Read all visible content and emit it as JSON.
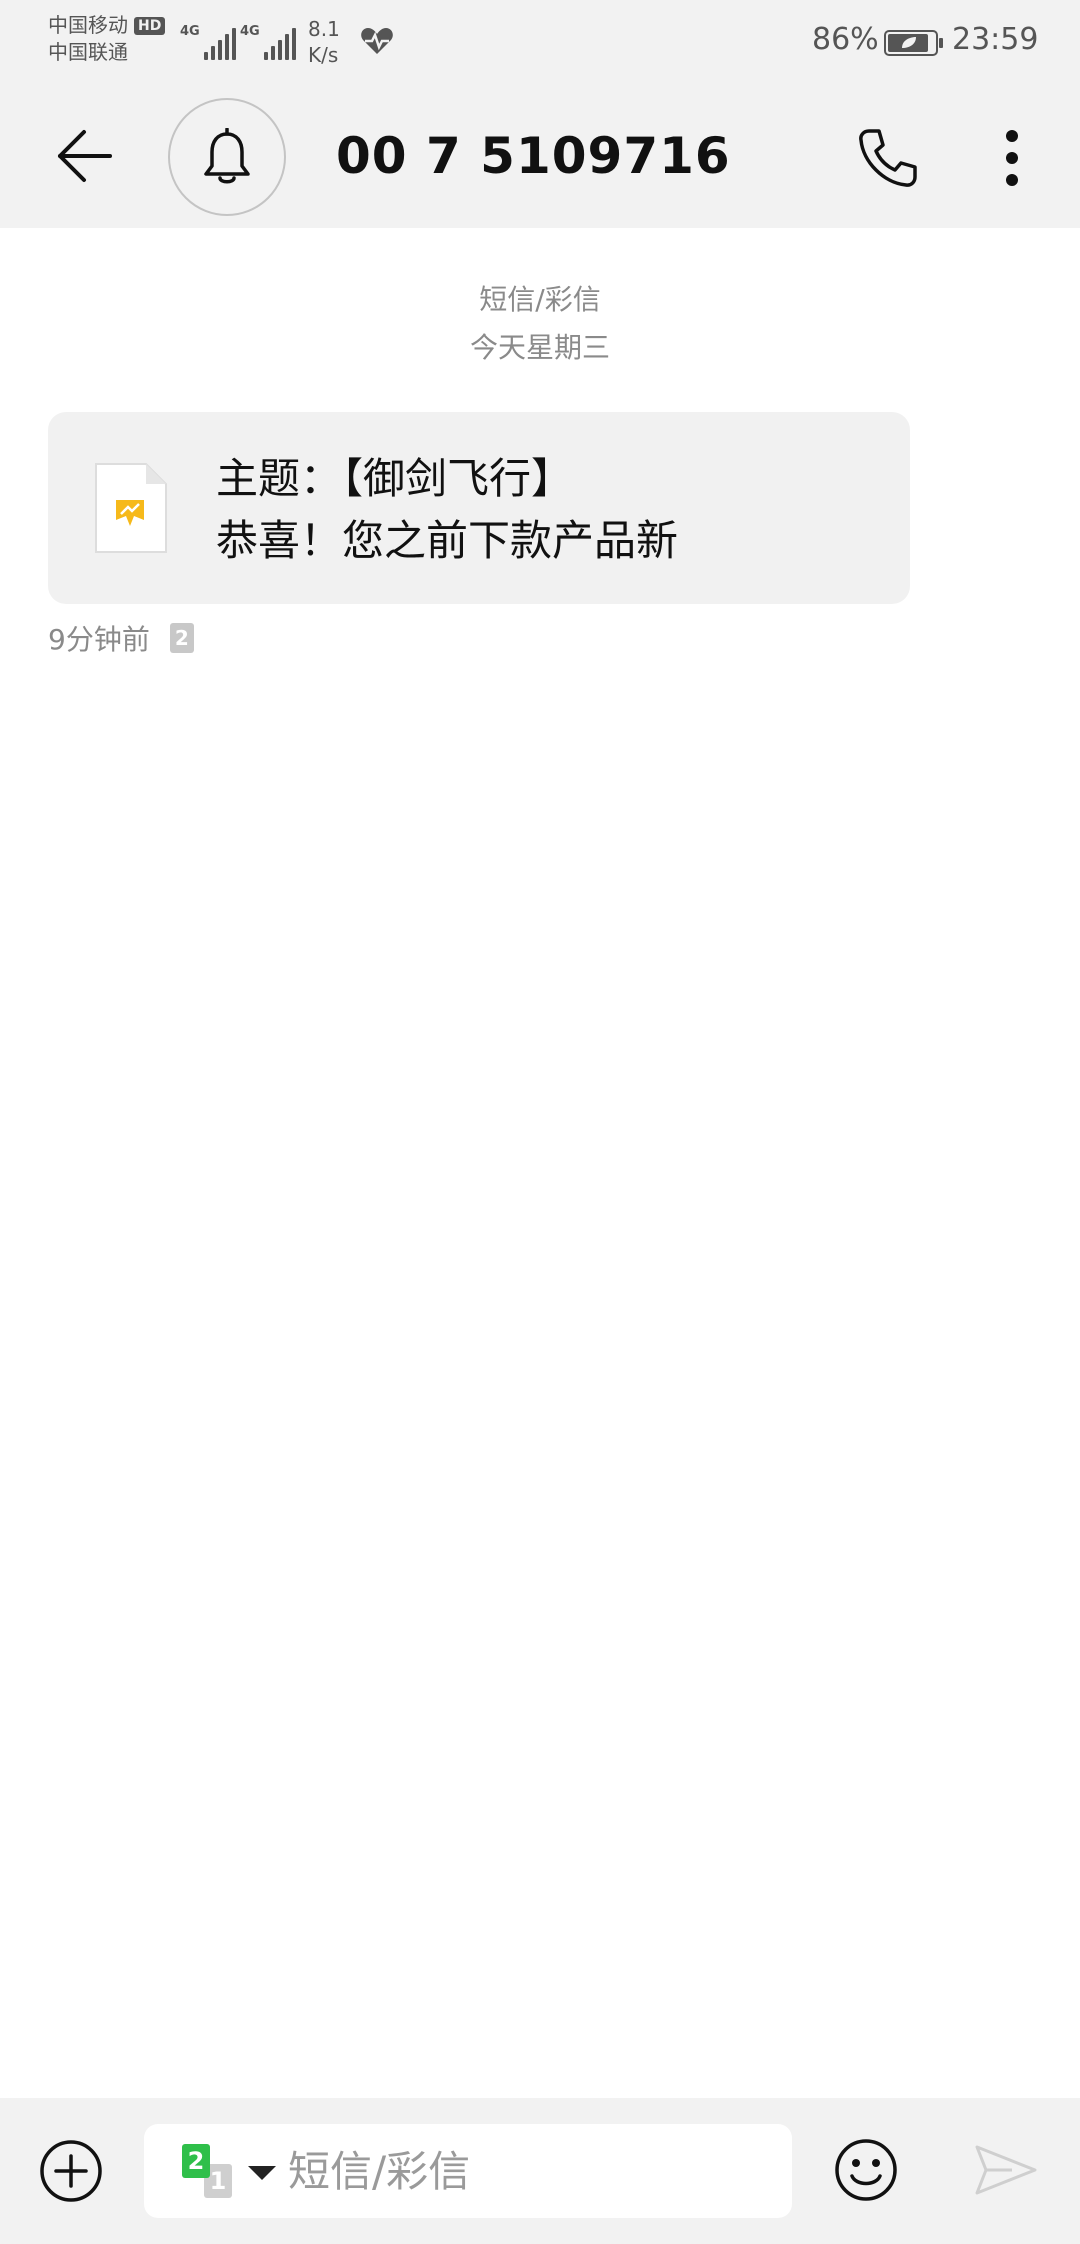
{
  "status_bar": {
    "carrier_1": "中国移动",
    "hd_badge": "HD",
    "carrier_2": "中国联通",
    "signal_1_label": "4G",
    "signal_2_label": "4G",
    "net_speed_value": "8.1",
    "net_speed_unit": "K/s",
    "battery_percent": "86%",
    "time": "23:59",
    "icons": [
      "heart-rate-icon",
      "battery-icon"
    ]
  },
  "header": {
    "title": "00 7 5109716",
    "icons": [
      "back-arrow-icon",
      "bell-icon",
      "phone-icon",
      "more-vert-icon"
    ]
  },
  "conversation": {
    "type_label": "短信/彩信",
    "date_label": "今天星期三",
    "messages": [
      {
        "line_1": "主题：【御剑飞行】",
        "line_2": "恭喜！您之前下款产品新",
        "time": "9分钟前",
        "sim_slot": "2",
        "attachment_icon": "mms-image-file-icon"
      }
    ]
  },
  "compose": {
    "placeholder": "短信/彩信",
    "value": "",
    "sim_active": "2",
    "sim_inactive": "1",
    "icons": [
      "add-circle-icon",
      "sim-switch-icon",
      "emoji-icon",
      "send-icon"
    ]
  },
  "colors": {
    "bar_background": "#f2f2f2",
    "bubble_background": "#f1f1f1",
    "sim_active": "#2fbf4a",
    "secondary_text": "#8a8a8a"
  }
}
